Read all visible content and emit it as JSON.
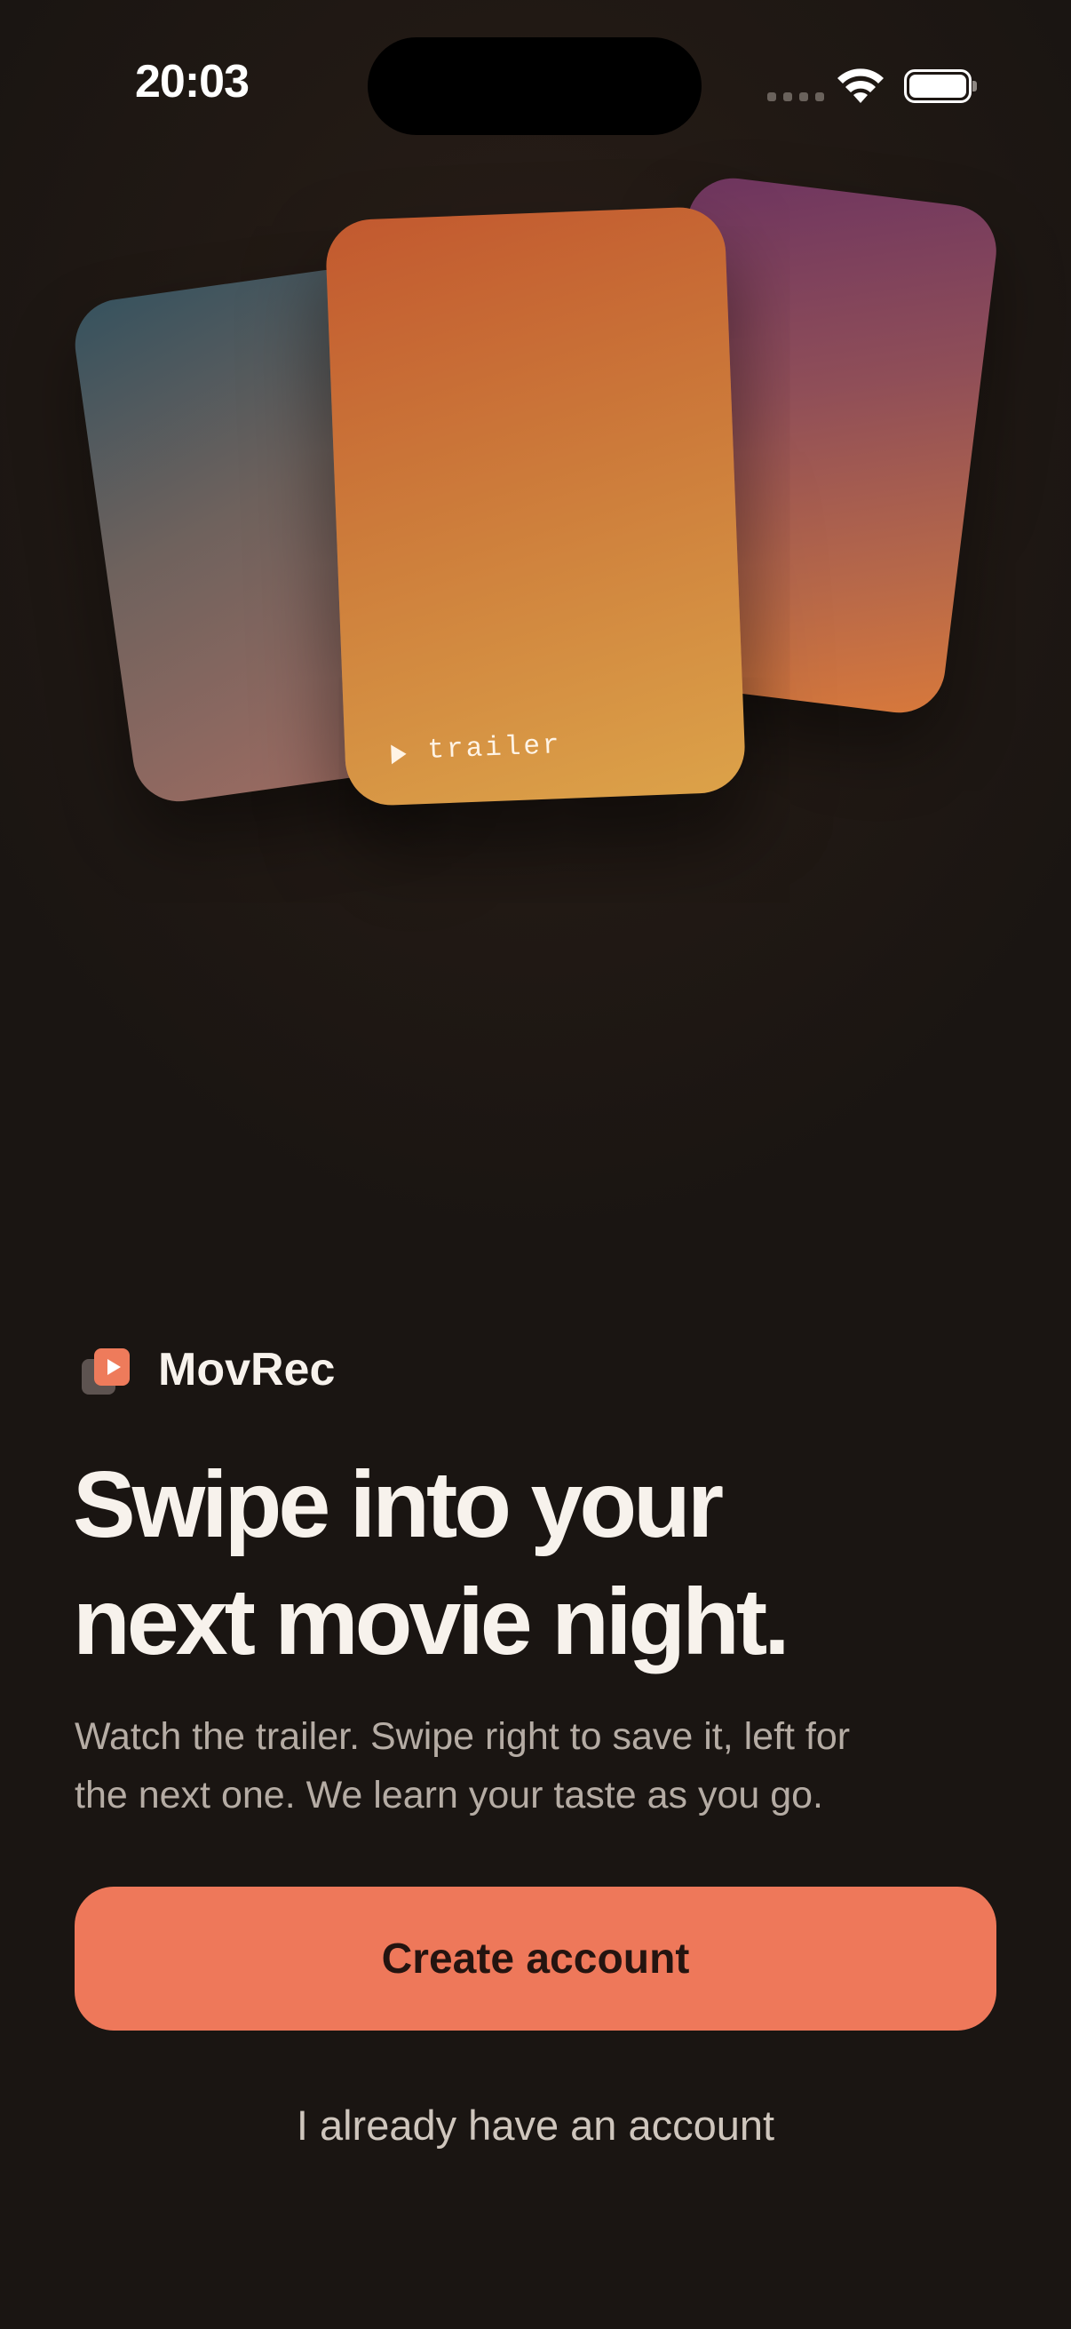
{
  "status_bar": {
    "time": "20:03",
    "icons": [
      "cellular-signal-icon",
      "wifi-icon",
      "battery-icon"
    ]
  },
  "hero": {
    "cards": [
      {
        "name": "left-poster-card",
        "color_top": "#36525e",
        "color_bottom": "#a06c62"
      },
      {
        "name": "center-poster-card",
        "color_top": "#c2592f",
        "color_bottom": "#dca249"
      },
      {
        "name": "right-poster-card",
        "color_top": "#6e3560",
        "color_bottom": "#d8793b"
      }
    ],
    "trailer_label": "trailer",
    "trailer_icon": "play-icon"
  },
  "brand": {
    "logo_icon": "movrec-logo-icon",
    "name": "MovRec"
  },
  "headline": {
    "line1": "Swipe into your",
    "line2": "next movie night."
  },
  "subtitle": {
    "line1": "Watch the trailer. Swipe right to save it, left for",
    "line2": "the next one. We learn your taste as you go."
  },
  "actions": {
    "primary_label": "Create account",
    "secondary_label": "I already have an account"
  },
  "colors": {
    "background": "#1a1512",
    "accent": "#ee785a",
    "text_primary": "#f7f2ec",
    "text_secondary": "#b5aca4"
  }
}
